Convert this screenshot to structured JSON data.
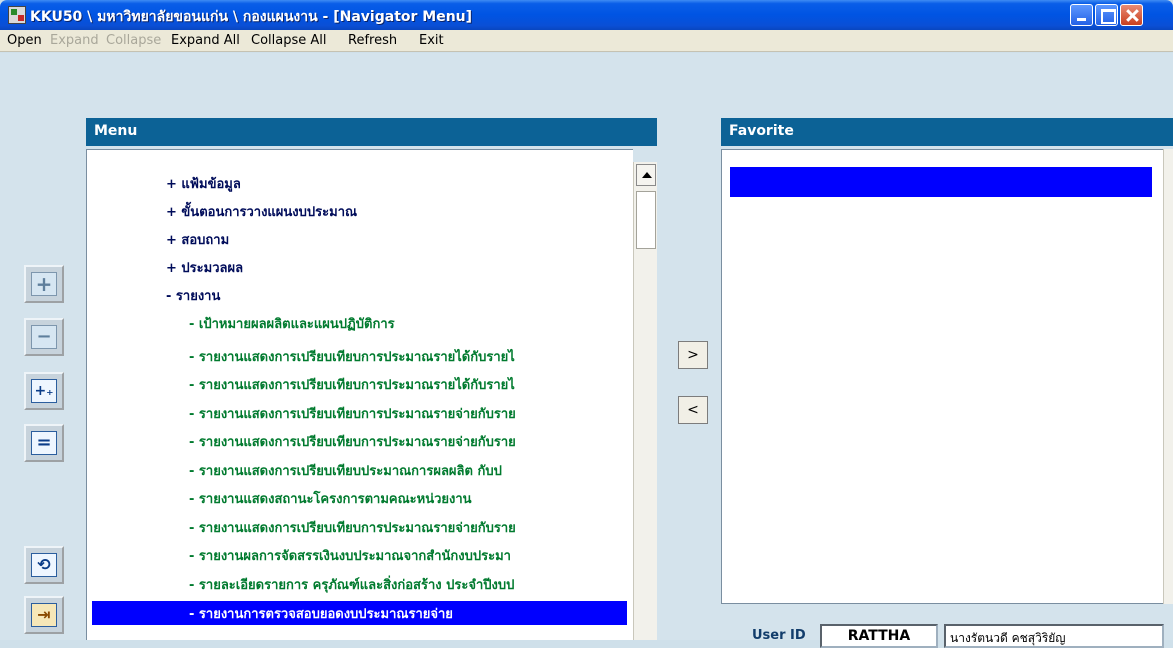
{
  "window": {
    "title": "KKU50 \\ มหาวิทยาลัยขอนแก่น \\ กองแผนงาน - [Navigator Menu]"
  },
  "menubar": {
    "open": "Open",
    "expand": "Expand",
    "collapse": "Collapse",
    "expand_all": "Expand All",
    "collapse_all": "Collapse All",
    "refresh": "Refresh",
    "exit": "Exit"
  },
  "menu_panel": {
    "title": "Menu",
    "top_items": [
      "+ แฟ้มข้อมูล",
      "+ ขั้นตอนการวางแผนงบประมาณ",
      "+ สอบถาม",
      "+ ประมวลผล",
      "- รายงาน"
    ],
    "sub_items": [
      "- เป้าหมายผลผลิตและแผนปฏิบัติการ",
      "- รายงานแสดงการเปรียบเทียบการประมาณรายได้กับรายไ",
      "- รายงานแสดงการเปรียบเทียบการประมาณรายได้กับรายไ",
      "- รายงานแสดงการเปรียบเทียบการประมาณรายจ่ายกับราย",
      "- รายงานแสดงการเปรียบเทียบการประมาณรายจ่ายกับราย",
      "- รายงานแสดงการเปรียบเทียบประมาณการผลผลิต กับป",
      "- รายงานแสดงสถานะโครงการตามคณะหน่วยงาน",
      "- รายงานแสดงการเปรียบเทียบการประมาณรายจ่ายกับราย",
      "- รายงานผลการจัดสรรเงินงบประมาณจากสำนักงบประมา",
      "- รายละเอียดรายการ ครุภัณฑ์และสิ่งก่อสร้าง ประจำปีงบป",
      "- รายงานการตรวจสอบยอดงบประมาณรายจ่าย"
    ]
  },
  "favorite_panel": {
    "title": "Favorite"
  },
  "move_buttons": {
    "add": ">",
    "remove": "<"
  },
  "footer": {
    "user_id_label": "User ID",
    "user_id": "RATTHA",
    "user_name": "นางรัตนวดี คชสุวิริยัญ"
  }
}
